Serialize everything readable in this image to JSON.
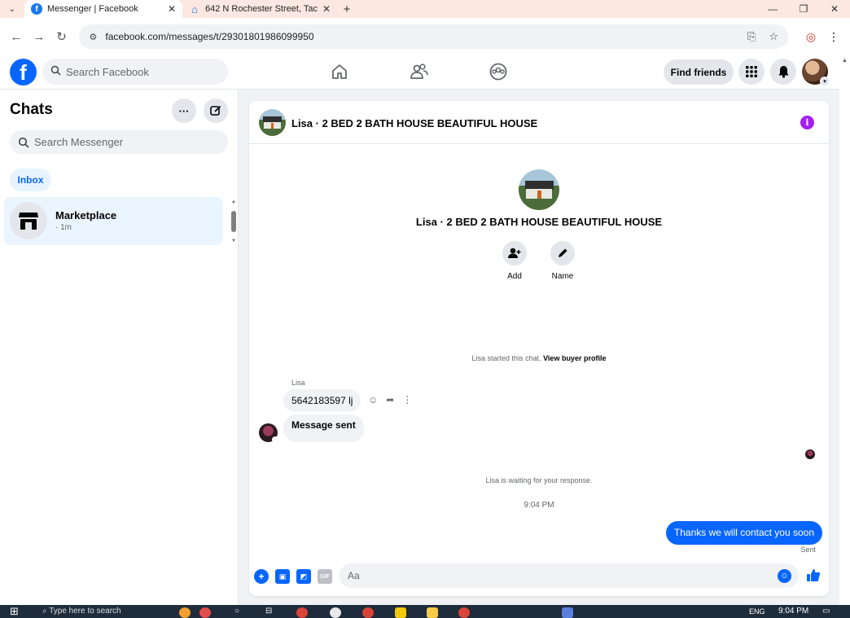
{
  "browser": {
    "tabs": [
      {
        "title": "Messenger | Facebook",
        "active": true
      },
      {
        "title": "642 N Rochester Street, Tacoma",
        "active": false
      }
    ],
    "url": "facebook.com/messages/t/29301801986099950"
  },
  "fb_header": {
    "search_placeholder": "Search Facebook",
    "find_friends_label": "Find friends"
  },
  "sidebar": {
    "title": "Chats",
    "search_placeholder": "Search Messenger",
    "filter_label": "Inbox",
    "chats": [
      {
        "name": "Marketplace",
        "time": "· 1m"
      }
    ]
  },
  "conversation": {
    "title": "Lisa · 2 BED 2 BATH HOUSE BEAUTIFUL HOUSE",
    "actions": [
      {
        "label": "Add"
      },
      {
        "label": "Name"
      }
    ],
    "started_text": "Lisa started this chat.",
    "view_profile_link": "View buyer profile",
    "sender_name": "Lisa",
    "messages_in": [
      {
        "text": "5642183597 lj"
      },
      {
        "text": "Message sent"
      }
    ],
    "waiting_text": "Lisa is waiting for your response.",
    "timestamp": "9:04 PM",
    "message_out": "Thanks we will contact you soon",
    "sent_status": "Sent",
    "composer_placeholder": "Aa"
  },
  "taskbar": {
    "search_placeholder": "Type here to search",
    "clock": "9:04 PM",
    "lang": "ENG"
  },
  "colors": {
    "fb_blue": "#0866ff",
    "info_purple": "#a41ff0",
    "tabstrip": "#fde8e1"
  }
}
